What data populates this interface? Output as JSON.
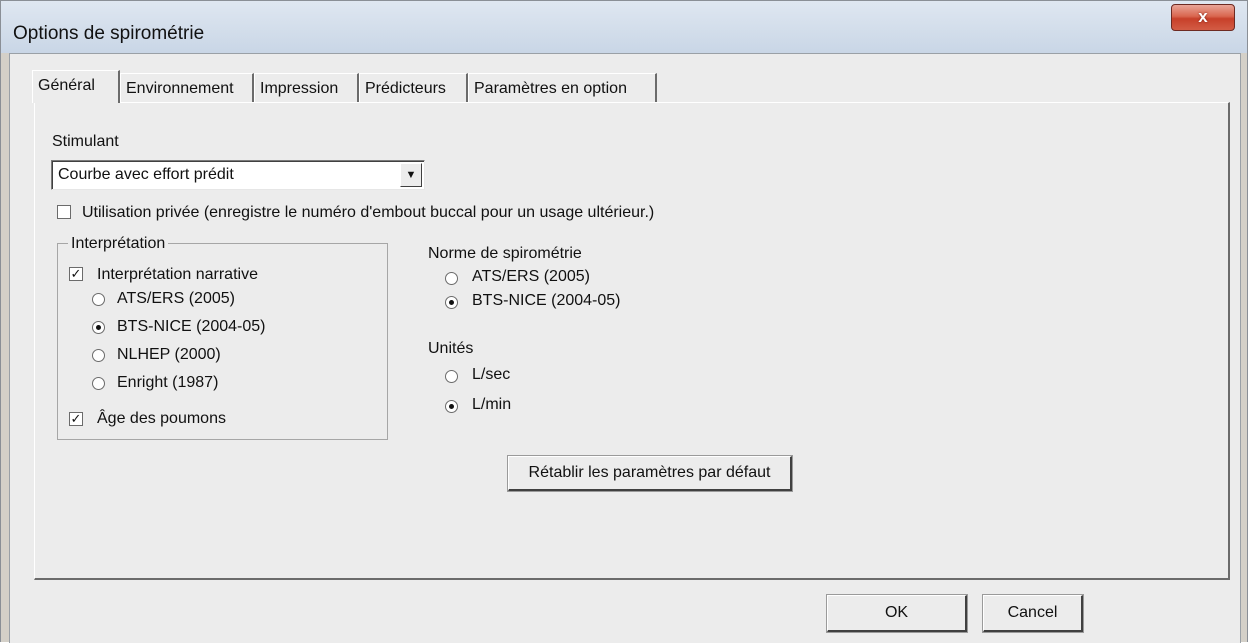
{
  "window": {
    "title": "Options de spirométrie",
    "close_label": "x"
  },
  "tabs": [
    {
      "label": "Général",
      "active": true
    },
    {
      "label": "Environnement",
      "active": false
    },
    {
      "label": "Impression",
      "active": false
    },
    {
      "label": "Prédicteurs",
      "active": false
    },
    {
      "label": "Paramètres en option",
      "active": false
    }
  ],
  "general": {
    "stimulant_label": "Stimulant",
    "stimulant_value": "Courbe avec effort prédit",
    "private_use_label": "Utilisation privée (enregistre le numéro d'embout buccal pour un usage ultérieur.)",
    "private_use_checked": false,
    "interpretation": {
      "group_label": "Interprétation",
      "narrative_label": "Interprétation narrative",
      "narrative_checked": true,
      "options": [
        "ATS/ERS (2005)",
        "BTS-NICE (2004-05)",
        "NLHEP (2000)",
        "Enright (1987)"
      ],
      "selected": "BTS-NICE (2004-05)",
      "lung_age_label": "Âge des poumons",
      "lung_age_checked": true
    },
    "norm": {
      "label": "Norme de spirométrie",
      "options": [
        "ATS/ERS (2005)",
        "BTS-NICE (2004-05)"
      ],
      "selected": "BTS-NICE (2004-05)"
    },
    "units": {
      "label": "Unités",
      "options": [
        "L/sec",
        "L/min"
      ],
      "selected": "L/min"
    },
    "reset_label": "Rétablir les paramètres par défaut"
  },
  "footer": {
    "ok_label": "OK",
    "cancel_label": "Cancel"
  }
}
